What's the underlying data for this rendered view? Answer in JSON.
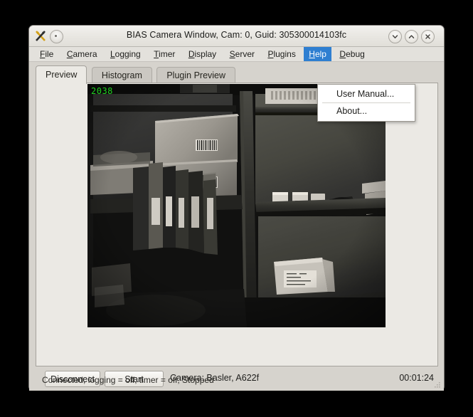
{
  "window": {
    "title": "BIAS Camera Window, Cam: 0, Guid: 305300014103fc",
    "logo_icon": "bias-app-icon",
    "window_menu_icon": "window-menu-dot-icon",
    "controls": [
      {
        "name": "minimize",
        "icon": "chevron-down-icon"
      },
      {
        "name": "maximize",
        "icon": "chevron-up-icon"
      },
      {
        "name": "close",
        "icon": "close-x-icon"
      }
    ]
  },
  "menubar": {
    "items": [
      {
        "label": "File",
        "accel": "F",
        "active": false
      },
      {
        "label": "Camera",
        "accel": "C",
        "active": false
      },
      {
        "label": "Logging",
        "accel": "L",
        "active": false
      },
      {
        "label": "Timer",
        "accel": "T",
        "active": false
      },
      {
        "label": "Display",
        "accel": "D",
        "active": false
      },
      {
        "label": "Server",
        "accel": "S",
        "active": false
      },
      {
        "label": "Plugins",
        "accel": "P",
        "active": false
      },
      {
        "label": "Help",
        "accel": "H",
        "active": true
      },
      {
        "label": "Debug",
        "accel": "D",
        "active": false
      }
    ],
    "highlight_color": "#2f7fd1"
  },
  "help_menu": {
    "open": true,
    "items": [
      {
        "label": "User Manual..."
      },
      {
        "label": "About..."
      }
    ]
  },
  "tabs": [
    {
      "label": "Preview",
      "selected": true
    },
    {
      "label": "Histogram",
      "selected": false
    },
    {
      "label": "Plugin Preview",
      "selected": false
    }
  ],
  "preview": {
    "frame_counter": "2038",
    "frame_counter_color": "#1fd11f",
    "scene_description": "grayscale shelving unit with cardboard boxes, barcode labels, binders and packages"
  },
  "controls": {
    "disconnect_label": "Disconnect",
    "start_label": "Start",
    "camera_label": "Camera:  Basler,  A622f",
    "timer_value": "00:01:24"
  },
  "statusbar": {
    "text": "Connected, logging = off, timer = off, Stopped",
    "grip_icon": "resize-grip-icon"
  }
}
